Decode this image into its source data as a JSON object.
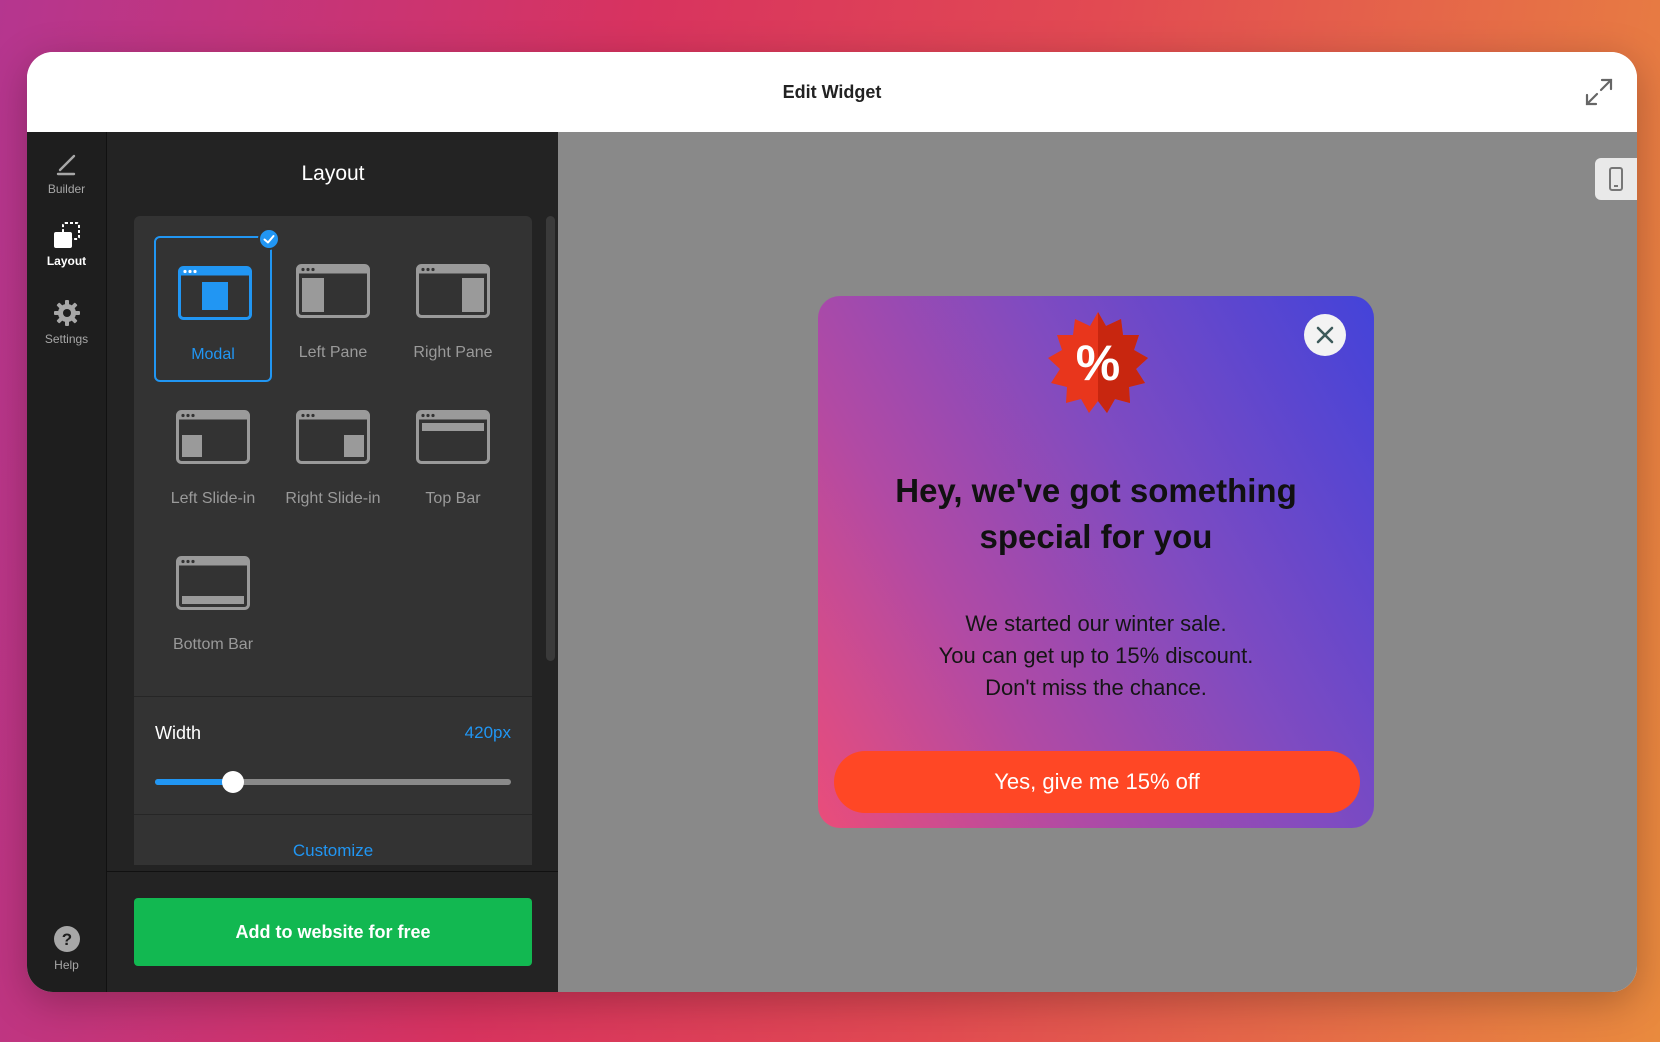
{
  "window": {
    "title": "Edit Widget"
  },
  "rail": {
    "items": [
      {
        "label": "Builder",
        "icon": "pencil-icon"
      },
      {
        "label": "Layout",
        "icon": "layout-icon",
        "active": true
      },
      {
        "label": "Settings",
        "icon": "gear-icon"
      }
    ],
    "help": {
      "label": "Help",
      "icon": "help-icon"
    }
  },
  "panel": {
    "title": "Layout",
    "layouts": [
      {
        "label": "Modal",
        "selected": true
      },
      {
        "label": "Left Pane"
      },
      {
        "label": "Right Pane"
      },
      {
        "label": "Left Slide-in"
      },
      {
        "label": "Right Slide-in"
      },
      {
        "label": "Top Bar"
      },
      {
        "label": "Bottom Bar"
      }
    ],
    "width": {
      "label": "Width",
      "value": "420px",
      "fraction": 0.22
    },
    "customize": "Customize",
    "add_button": "Add to website for free"
  },
  "preview": {
    "badge_text": "%",
    "headline": "Hey, we've got something special for you",
    "body_lines": [
      "We started our winter sale.",
      "You can get up to 15% discount.",
      "Don't miss the chance."
    ],
    "cta": "Yes, give me 15% off"
  },
  "colors": {
    "accent_blue": "#2196f3",
    "cta_green": "#12b851",
    "offer_orange": "#ff4725"
  }
}
